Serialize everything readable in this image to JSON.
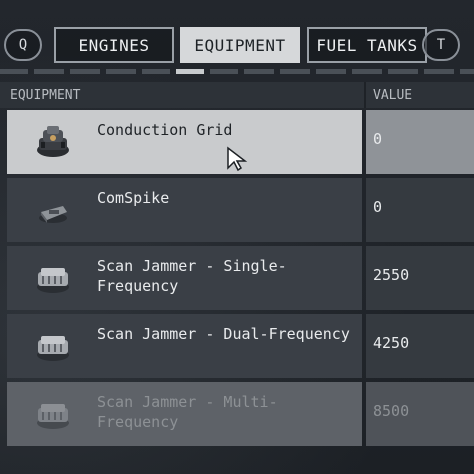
{
  "tabs": {
    "key_left": "Q",
    "key_right": "T",
    "items": [
      {
        "label": "ENGINES",
        "active": false
      },
      {
        "label": "EQUIPMENT",
        "active": true
      },
      {
        "label": "FUEL TANKS",
        "active": false
      }
    ]
  },
  "table": {
    "header_equipment": "EQUIPMENT",
    "header_value": "VALUE",
    "rows": [
      {
        "name": "Conduction Grid",
        "value": "0",
        "icon": "conduction-grid-module-icon",
        "state": "selected"
      },
      {
        "name": "ComSpike",
        "value": "0",
        "icon": "comspike-module-icon",
        "state": "normal"
      },
      {
        "name": "Scan Jammer - Single-Frequency",
        "value": "2550",
        "icon": "scan-jammer-module-icon",
        "state": "normal"
      },
      {
        "name": "Scan Jammer - Dual-Frequency",
        "value": "4250",
        "icon": "scan-jammer-module-icon",
        "state": "normal"
      },
      {
        "name": "Scan Jammer - Multi-Frequency",
        "value": "8500",
        "icon": "scan-jammer-module-icon",
        "state": "unavailable"
      }
    ]
  },
  "colors": {
    "accent_active_tab": "#d6d8da",
    "row_selected": "#c9cbcd",
    "row_normal": "#3a3f46",
    "text_light": "#e9ebed"
  }
}
